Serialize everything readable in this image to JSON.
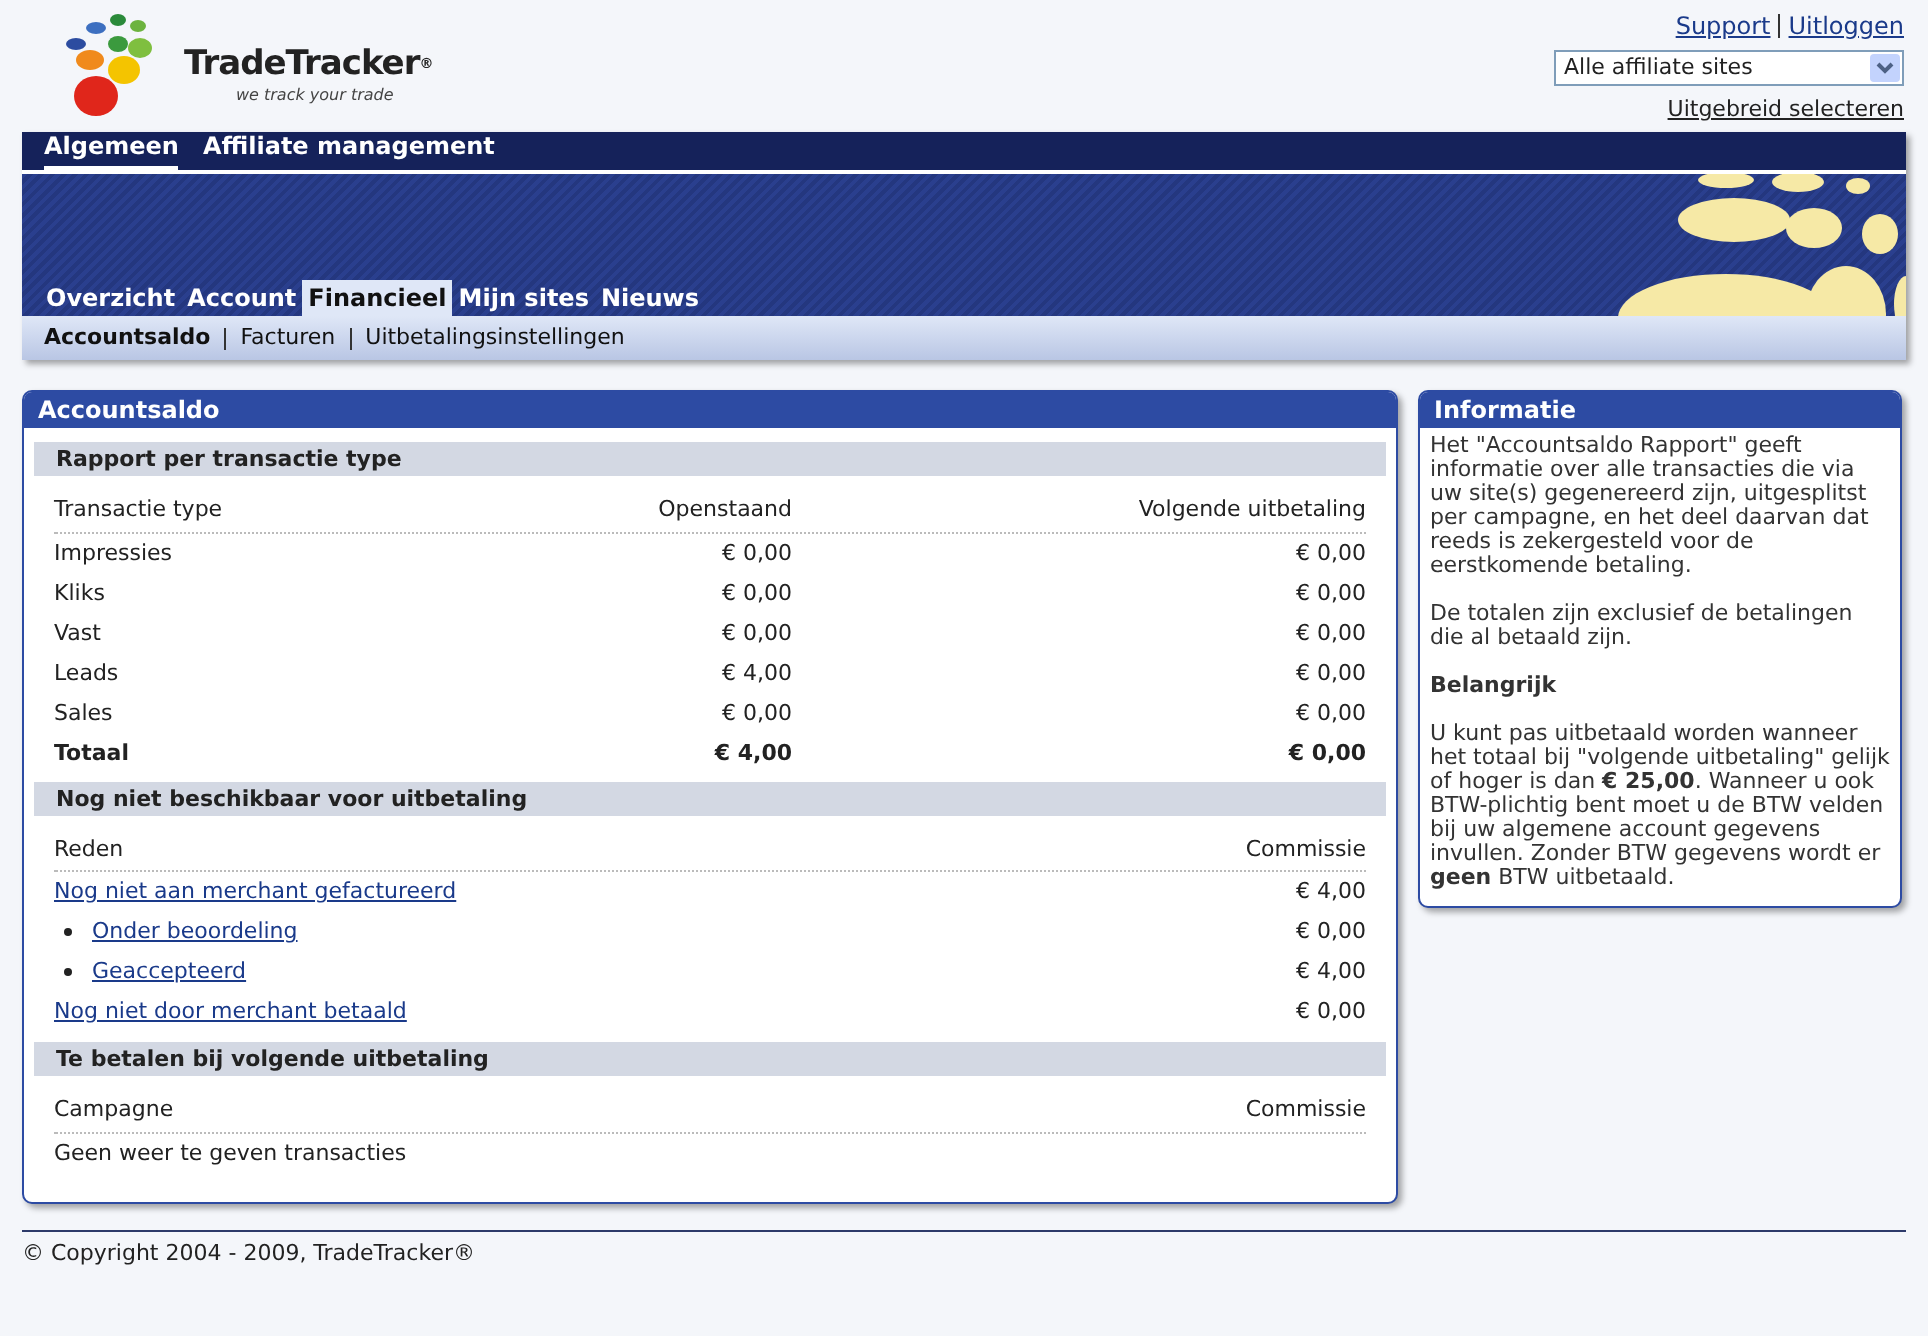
{
  "logo": {
    "name": "TradeTracker",
    "mark": "®",
    "tagline": "we track your trade"
  },
  "top_links": [
    "Support",
    "Uitloggen"
  ],
  "site_select": {
    "value": "Alle affiliate sites"
  },
  "advanced_link": "Uitgebreid selecteren",
  "main_nav": [
    {
      "label": "Algemeen",
      "selected": true
    },
    {
      "label": "Affiliate management",
      "selected": false
    }
  ],
  "tabs": [
    {
      "label": "Overzicht",
      "selected": false
    },
    {
      "label": "Account",
      "selected": false
    },
    {
      "label": "Financieel",
      "selected": true
    },
    {
      "label": "Mijn sites",
      "selected": false
    },
    {
      "label": "Nieuws",
      "selected": false
    }
  ],
  "sub_nav": [
    {
      "label": "Accountsaldo",
      "selected": true
    },
    {
      "label": "Facturen",
      "selected": false
    },
    {
      "label": "Uitbetalingsinstellingen",
      "selected": false
    }
  ],
  "main_panel": {
    "title": "Accountsaldo",
    "report": {
      "heading": "Rapport per transactie type",
      "columns": [
        "Transactie type",
        "Openstaand",
        "Volgende uitbetaling"
      ],
      "rows": [
        {
          "kind": "normal",
          "cells": [
            "Impressies",
            "€ 0,00",
            "€ 0,00"
          ]
        },
        {
          "kind": "normal",
          "cells": [
            "Kliks",
            "€ 0,00",
            "€ 0,00"
          ]
        },
        {
          "kind": "normal",
          "cells": [
            "Vast",
            "€ 0,00",
            "€ 0,00"
          ]
        },
        {
          "kind": "normal",
          "cells": [
            "Leads",
            "€ 4,00",
            "€ 0,00"
          ]
        },
        {
          "kind": "normal",
          "cells": [
            "Sales",
            "€ 0,00",
            "€ 0,00"
          ]
        },
        {
          "kind": "total",
          "cells": [
            "Totaal",
            "€ 4,00",
            "€ 0,00"
          ]
        }
      ]
    },
    "pending": {
      "heading": "Nog niet beschikbaar voor uitbetaling",
      "columns": [
        "Reden",
        "Commissie"
      ],
      "rows": [
        {
          "kind": "link",
          "reason": "Nog niet aan merchant gefactureerd",
          "amount": "€ 4,00"
        },
        {
          "kind": "bullet",
          "reason": "Onder beoordeling",
          "amount": "€ 0,00"
        },
        {
          "kind": "bullet",
          "reason": "Geaccepteerd",
          "amount": "€ 4,00"
        },
        {
          "kind": "link",
          "reason": "Nog niet door merchant betaald",
          "amount": "€ 0,00"
        }
      ]
    },
    "next": {
      "heading": "Te betalen bij volgende uitbetaling",
      "columns": [
        "Campagne",
        "Commissie"
      ],
      "empty": "Geen weer te geven transacties"
    }
  },
  "info_panel": {
    "title": "Informatie",
    "paragraphs": [
      {
        "kind": "text",
        "text": "Het \"Accountsaldo Rapport\" geeft informatie over alle transacties die via uw site(s) gegenereerd zijn, uitgesplitst per campagne, en het deel daarvan dat reeds is zekergesteld voor de eerstkomende betaling."
      },
      {
        "kind": "text",
        "text": "De totalen zijn exclusief de betalingen die al betaald zijn."
      },
      {
        "kind": "heading",
        "text": "Belangrijk"
      },
      {
        "kind": "text",
        "text": "U kunt pas uitbetaald worden wanneer het totaal bij \"volgende uitbetaling\" gelijk of hoger is dan **€ 25,00**. Wanneer u ook BTW-plichtig bent moet u de BTW velden bij uw algemene account gegevens invullen. Zonder BTW gegevens wordt er **geen** BTW uitbetaald."
      }
    ]
  },
  "footer": "© Copyright 2004 - 2009, TradeTracker®"
}
